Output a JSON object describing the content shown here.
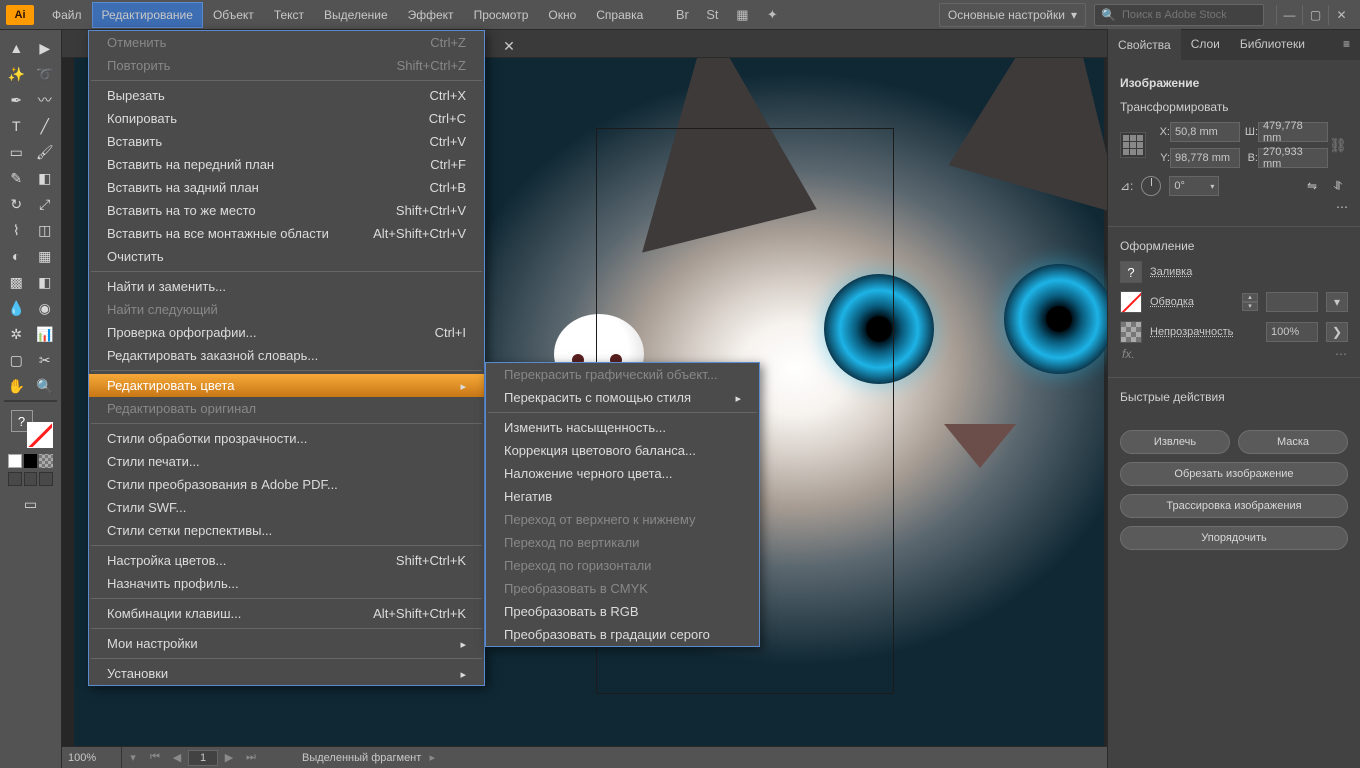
{
  "menubar": {
    "items": [
      "Файл",
      "Редактирование",
      "Объект",
      "Текст",
      "Выделение",
      "Эффект",
      "Просмотр",
      "Окно",
      "Справка"
    ],
    "workspace_label": "Основные настройки",
    "search_placeholder": "Поиск в Adobe Stock"
  },
  "edit_menu": [
    {
      "label": "Отменить",
      "shortcut": "Ctrl+Z",
      "disabled": true
    },
    {
      "label": "Повторить",
      "shortcut": "Shift+Ctrl+Z",
      "disabled": true
    },
    {
      "sep": true
    },
    {
      "label": "Вырезать",
      "shortcut": "Ctrl+X"
    },
    {
      "label": "Копировать",
      "shortcut": "Ctrl+C"
    },
    {
      "label": "Вставить",
      "shortcut": "Ctrl+V"
    },
    {
      "label": "Вставить на передний план",
      "shortcut": "Ctrl+F"
    },
    {
      "label": "Вставить на задний план",
      "shortcut": "Ctrl+B"
    },
    {
      "label": "Вставить на то же место",
      "shortcut": "Shift+Ctrl+V"
    },
    {
      "label": "Вставить на все монтажные области",
      "shortcut": "Alt+Shift+Ctrl+V"
    },
    {
      "label": "Очистить"
    },
    {
      "sep": true
    },
    {
      "label": "Найти и заменить..."
    },
    {
      "label": "Найти следующий",
      "disabled": true
    },
    {
      "label": "Проверка орфографии...",
      "shortcut": "Ctrl+I"
    },
    {
      "label": "Редактировать заказной словарь..."
    },
    {
      "sep": true
    },
    {
      "label": "Редактировать цвета",
      "submenu": true,
      "highlight": true
    },
    {
      "label": "Редактировать оригинал",
      "disabled": true
    },
    {
      "sep": true
    },
    {
      "label": "Стили обработки прозрачности..."
    },
    {
      "label": "Стили печати..."
    },
    {
      "label": "Стили преобразования в Adobe PDF..."
    },
    {
      "label": "Стили SWF..."
    },
    {
      "label": "Стили сетки перспективы..."
    },
    {
      "sep": true
    },
    {
      "label": "Настройка цветов...",
      "shortcut": "Shift+Ctrl+K"
    },
    {
      "label": "Назначить профиль..."
    },
    {
      "sep": true
    },
    {
      "label": "Комбинации клавиш...",
      "shortcut": "Alt+Shift+Ctrl+K"
    },
    {
      "sep": true
    },
    {
      "label": "Мои настройки",
      "submenu": true
    },
    {
      "sep": true
    },
    {
      "label": "Установки",
      "submenu": true
    }
  ],
  "edit_colors_submenu": [
    {
      "label": "Перекрасить графический объект...",
      "disabled": true
    },
    {
      "label": "Перекрасить с помощью стиля",
      "submenu": true
    },
    {
      "sep": true
    },
    {
      "label": "Изменить насыщенность..."
    },
    {
      "label": "Коррекция цветового баланса..."
    },
    {
      "label": "Наложение черного цвета..."
    },
    {
      "label": "Негатив"
    },
    {
      "label": "Переход от верхнего к нижнему",
      "disabled": true
    },
    {
      "label": "Переход по вертикали",
      "disabled": true
    },
    {
      "label": "Переход по горизонтали",
      "disabled": true
    },
    {
      "label": "Преобразовать в CMYK",
      "disabled": true
    },
    {
      "label": "Преобразовать в RGB"
    },
    {
      "label": "Преобразовать в градации серого"
    }
  ],
  "properties": {
    "tabs": [
      "Свойства",
      "Слои",
      "Библиотеки"
    ],
    "object_type": "Изображение",
    "transform_header": "Трансформировать",
    "x_label": "X:",
    "x_value": "50,8 mm",
    "w_label": "Ш:",
    "w_value": "479,778 mm",
    "y_label": "Y:",
    "y_value": "98,778 mm",
    "h_label": "В:",
    "h_value": "270,933 mm",
    "angle_label": "⊿:",
    "angle_value": "0°",
    "appearance_header": "Оформление",
    "fill_label": "Заливка",
    "stroke_label": "Обводка",
    "opacity_label": "Непрозрачность",
    "opacity_value": "100%",
    "fx_label": "fx.",
    "quick_actions_header": "Быстрые действия",
    "btn_extract": "Извлечь",
    "btn_mask": "Маска",
    "btn_crop": "Обрезать изображение",
    "btn_trace": "Трассировка изображения",
    "btn_arrange": "Упорядочить"
  },
  "statusbar": {
    "zoom": "100%",
    "page": "1",
    "status": "Выделенный фрагмент"
  }
}
